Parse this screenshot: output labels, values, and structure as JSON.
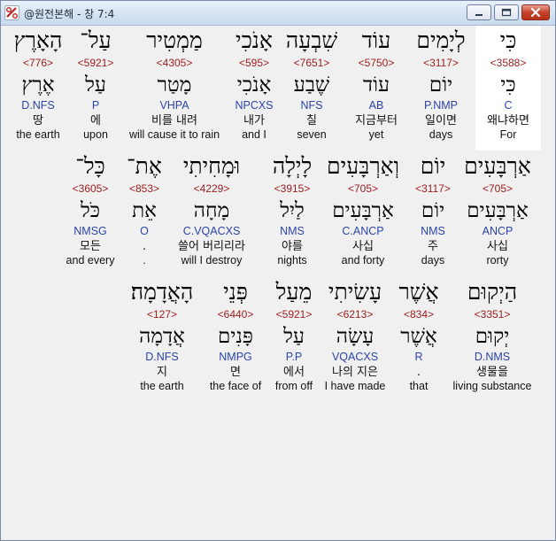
{
  "window": {
    "title": "@원전본해 - 창 7:4"
  },
  "rows": [
    {
      "words": [
        {
          "heb": "כִּי",
          "num": "<3588>",
          "lex": "כִּי",
          "morph": "C",
          "kor": "왜냐하면",
          "eng": "For",
          "highlighted": true
        },
        {
          "heb": "לְיָמִים",
          "num": "<3117>",
          "lex": "יוֹם",
          "morph": "P.NMP",
          "kor": "일이면",
          "eng": "days"
        },
        {
          "heb": "עוֹד",
          "num": "<5750>",
          "lex": "עוֹד",
          "morph": "AB",
          "kor": "지금부터",
          "eng": "yet"
        },
        {
          "heb": "שִׁבְעָה",
          "num": "<7651>",
          "lex": "שֶׁבַע",
          "morph": "NFS",
          "kor": "칠",
          "eng": "seven"
        },
        {
          "heb": "אָנֹכִי",
          "num": "<595>",
          "lex": "אָנֹכִי",
          "morph": "NPCXS",
          "kor": "내가",
          "eng": "and I"
        },
        {
          "heb": "מַמְטִיר",
          "num": "<4305>",
          "lex": "מָטַר",
          "morph": "VHPA",
          "kor": "비를 내려",
          "eng": "will cause it to rain"
        },
        {
          "heb": "עַל־",
          "num": "<5921>",
          "lex": "עַל",
          "morph": "P",
          "kor": "에",
          "eng": "upon"
        },
        {
          "heb": "הָאָרֶץ",
          "num": "<776>",
          "lex": "אֶרֶץ",
          "morph": "D.NFS",
          "kor": "땅",
          "eng": "the earth"
        }
      ]
    },
    {
      "words": [
        {
          "heb": "אַרְבָּעִים",
          "num": "<705>",
          "lex": "אַרְבָּעִים",
          "morph": "ANCP",
          "kor": "사십",
          "eng": "rorty"
        },
        {
          "heb": "יוֹם",
          "num": "<3117>",
          "lex": "יוֹם",
          "morph": "NMS",
          "kor": "주",
          "eng": "days"
        },
        {
          "heb": "וְאַרְבָּעִים",
          "num": "<705>",
          "lex": "אַרְבָּעִים",
          "morph": "C.ANCP",
          "kor": "사십",
          "eng": "and forty"
        },
        {
          "heb": "לָיְלָה",
          "num": "<3915>",
          "lex": "לַיִל",
          "morph": "NMS",
          "kor": "야를",
          "eng": "nights"
        },
        {
          "heb": "וּמָחִיתִי",
          "num": "<4229>",
          "lex": "מָחָה",
          "morph": "C.VQACXS",
          "kor": "쓸어 버리리라",
          "eng": "will I destroy"
        },
        {
          "heb": "אֶת־",
          "num": "<853>",
          "lex": "אֵת",
          "morph": "O",
          "kor": ".",
          "eng": "."
        },
        {
          "heb": "כָּל־",
          "num": "<3605>",
          "lex": "כֹּל",
          "morph": "NMSG",
          "kor": "모든",
          "eng": "and every"
        }
      ]
    },
    {
      "words": [
        {
          "heb": "הַיְקוּם",
          "num": "<3351>",
          "lex": "יְקוּם",
          "morph": "D.NMS",
          "kor": "생물을",
          "eng": "living substance"
        },
        {
          "heb": "אֲשֶׁר",
          "num": "<834>",
          "lex": "אֲשֶׁר",
          "morph": "R",
          "kor": ".",
          "eng": "that"
        },
        {
          "heb": "עָשִׂיתִי",
          "num": "<6213>",
          "lex": "עָשָׂה",
          "morph": "VQACXS",
          "kor": "나의 지은",
          "eng": "I have made"
        },
        {
          "heb": "מֵעַל",
          "num": "<5921>",
          "lex": "עַל",
          "morph": "P.P",
          "kor": "에서",
          "eng": "from off"
        },
        {
          "heb": "פְּנֵי",
          "num": "<6440>",
          "lex": "פָּנִים",
          "morph": "NMPG",
          "kor": "면",
          "eng": "the face of"
        },
        {
          "heb": "הָאֲדָמָה׃",
          "num": "<127>",
          "lex": "אֲדָמָה",
          "morph": "D.NFS",
          "kor": "지",
          "eng": "the earth"
        }
      ]
    }
  ]
}
